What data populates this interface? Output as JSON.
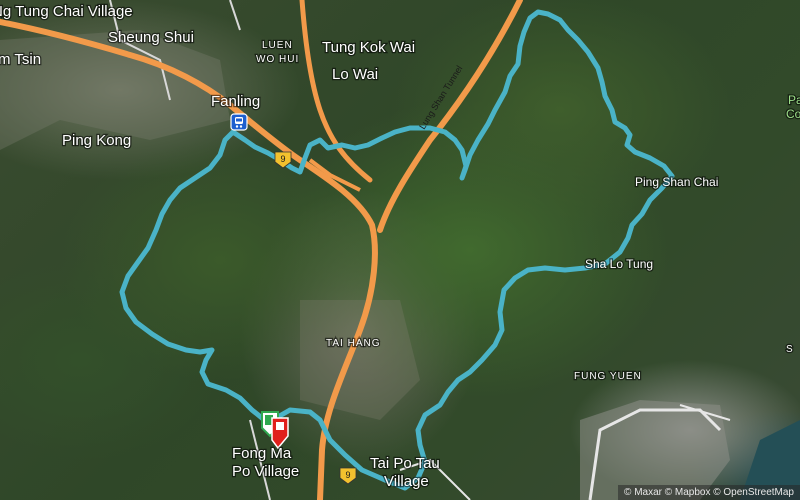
{
  "map": {
    "place_labels": [
      {
        "text": "Ng Tung Chai Village"
      },
      {
        "text": "Sheung Shui"
      },
      {
        "text": "m Tsin"
      },
      {
        "text": "LUEN"
      },
      {
        "text": "WO HUI"
      },
      {
        "text": "Tung Kok Wai"
      },
      {
        "text": "Lo Wai"
      },
      {
        "text": "Fanling"
      },
      {
        "text": "Ping Kong"
      },
      {
        "text": "Ping Shan Chai"
      },
      {
        "text": "Sha Lo Tung"
      },
      {
        "text": "TAI HANG"
      },
      {
        "text": "FUNG YUEN"
      },
      {
        "text": "Fong Ma"
      },
      {
        "text": "Po Village"
      },
      {
        "text": "Tai Po Tau"
      },
      {
        "text": "Village"
      },
      {
        "text": "S"
      },
      {
        "text": "Pa"
      },
      {
        "text": "Co"
      }
    ],
    "road_labels": [
      {
        "text": "Lung Shan Tunnel"
      }
    ],
    "route_shields": [
      {
        "text": "9"
      },
      {
        "text": "9"
      }
    ],
    "attribution": "© Maxar © Mapbox © OpenStreetMap",
    "colors": {
      "route": "#4ab3c7",
      "highway": "#f29a4a",
      "start_marker": "#2fa84f",
      "end_marker": "#e0201c",
      "station": "#1e5fcf"
    },
    "icons": [
      "mtr-station-icon",
      "start-flag-icon",
      "end-flag-icon"
    ]
  }
}
